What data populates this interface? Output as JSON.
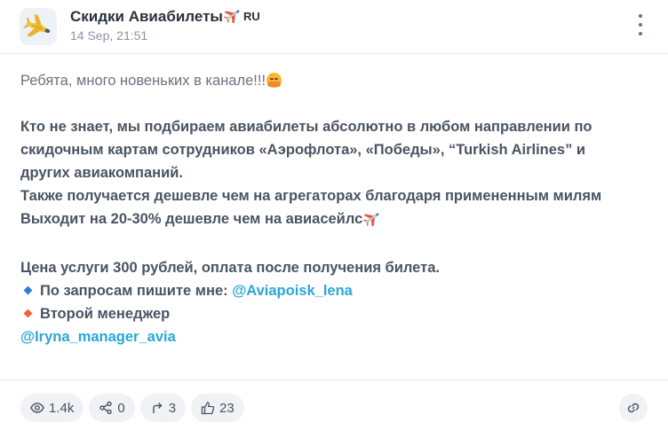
{
  "channel": {
    "title": "Скидки Авиабилеты",
    "title_suffix": "RU",
    "timestamp": "14 Sep, 21:51",
    "avatar_icon": "airplane-icon"
  },
  "post": {
    "intro": "Ребята, много новеньких в канале!!!",
    "intro_emoji": "hugging-face-icon",
    "p1_l1": "Кто не знает, мы подбираем авиабилеты абсолютно в любом направлении по",
    "p1_l2": "скидочным картам сотрудников «Аэрофлота», «Победы», “Turkish Airlines” и",
    "p1_l3": "других авиакомпаний.",
    "p1_l4": "Также получается дешевле чем на агрегаторах благодаря примененным милям",
    "p1_l5": "Выходит на 20-30% дешевле чем на авиасейлс",
    "price": "Цена услуги 300 рублей, оплата после получения билета.",
    "request_label": "По запросам пишите мне:",
    "request_link": "@Aviapoisk_lena",
    "second_manager_label": "Второй менеджер",
    "second_manager_link": "@Iryna_manager_avia",
    "colors": {
      "blue_diamond": "#2f7fd6",
      "orange_diamond": "#f0643c",
      "link": "#2aa6d8"
    }
  },
  "stats": {
    "views": "1.4k",
    "shares": "0",
    "forwards": "3",
    "likes": "23"
  }
}
